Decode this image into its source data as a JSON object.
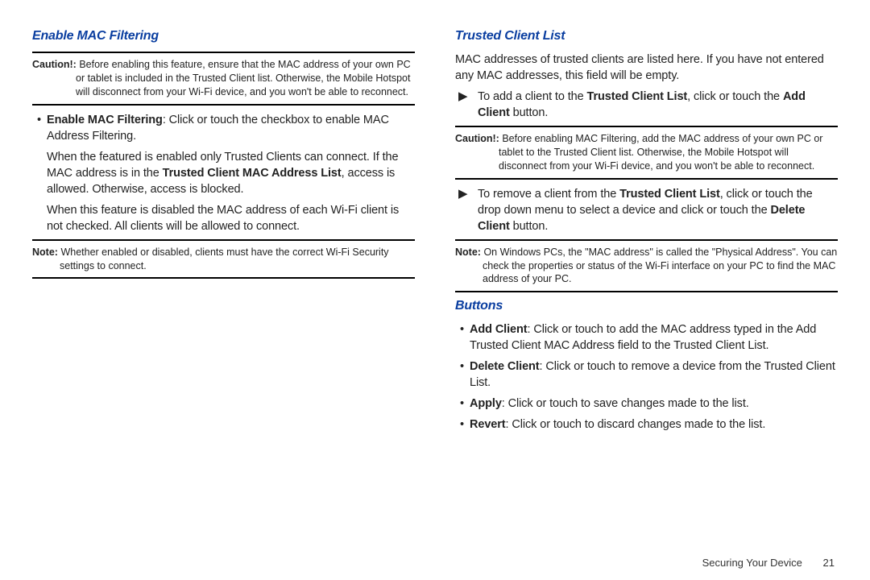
{
  "left": {
    "heading": "Enable MAC Filtering",
    "caution_label": "Caution!:",
    "caution_text": "Before enabling this feature, ensure that the MAC address of your own PC or tablet is included in the Trusted Client list. Otherwise, the Mobile Hotspot will disconnect from your Wi-Fi device, and you won't be able to reconnect.",
    "p1_lead_bold": "Enable MAC Filtering",
    "p1_rest": ": Click or touch the checkbox to enable MAC Address Filtering.",
    "p2a": "When the featured is enabled only Trusted Clients can connect. If the MAC address is in the ",
    "p2_bold": "Trusted Client MAC Address List",
    "p2b": ", access is allowed. Otherwise, access is blocked.",
    "p3": "When this feature is disabled the MAC address of each Wi-Fi client is not checked. All clients will be allowed to connect.",
    "note_label": "Note:",
    "note_text": "Whether enabled or disabled, clients must have the correct Wi-Fi Security settings to connect."
  },
  "right": {
    "heading1": "Trusted Client List",
    "intro": "MAC addresses of trusted clients are listed here. If you have not entered any MAC addresses, this field will be empty.",
    "arrow1_a": "To add a client to the ",
    "arrow1_bold1": "Trusted Client List",
    "arrow1_b": ", click or touch the ",
    "arrow1_bold2": "Add Client",
    "arrow1_c": " button.",
    "caution_label": "Caution!:",
    "caution_text": "Before enabling MAC Filtering, add the MAC address of your own PC or tablet to the Trusted Client list. Otherwise, the Mobile Hotspot will disconnect from your Wi-Fi device, and you won't be able to reconnect.",
    "arrow2_a": "To remove a client from the ",
    "arrow2_bold1": "Trusted Client List",
    "arrow2_b": ", click or touch the drop down menu to select a device and click or touch the ",
    "arrow2_bold2": "Delete Client",
    "arrow2_c": " button.",
    "note_label": "Note:",
    "note_text": "On Windows PCs, the \"MAC address\" is called the \"Physical Address\". You can check the properties or status of the Wi-Fi interface on your PC to find the MAC address of your PC.",
    "heading2": "Buttons",
    "b_add_bold": "Add Client",
    "b_add_rest": ": Click or touch to add the MAC address typed in the Add Trusted Client MAC Address field to the Trusted Client List.",
    "b_del_bold": "Delete Client",
    "b_del_rest": ": Click or touch to remove a device from the Trusted Client List.",
    "b_apply_bold": "Apply",
    "b_apply_rest": ": Click or touch to save changes made to the list.",
    "b_revert_bold": "Revert",
    "b_revert_rest": ": Click or touch to discard changes made to the list."
  },
  "footer": {
    "section": "Securing Your Device",
    "page": "21"
  },
  "glyphs": {
    "arrow": "▶"
  }
}
